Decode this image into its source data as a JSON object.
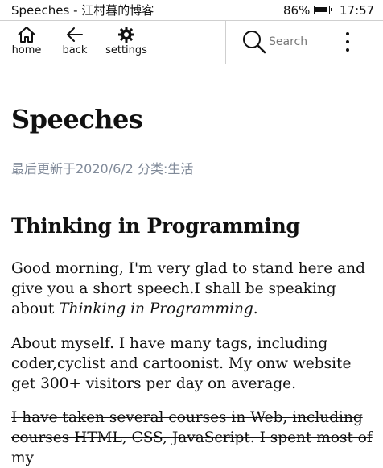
{
  "status_bar": {
    "title": "Speeches - 江村暮的博客",
    "battery": "86%",
    "time": "17:57"
  },
  "toolbar": {
    "home_label": "home",
    "back_label": "back",
    "settings_label": "settings",
    "search_placeholder": "Search",
    "icons": [
      "home-icon",
      "back-arrow-icon",
      "gear-icon",
      "search-icon",
      "more-vertical-icon"
    ]
  },
  "article": {
    "title": "Speeches",
    "meta": "最后更新于2020/6/2 分类:生活",
    "heading": "Thinking in Programming",
    "p1_before": "Good morning, I'm very glad to stand here and give you a short speech.I shall be speaking about ",
    "p1_italic": "Thinking in Programming",
    "p1_after": ".",
    "p2": "About myself. I have many tags, including coder,cyclist and cartoonist. My onw website get 300+ visitors per day on average.",
    "p3": "I have taken several courses in Web, including courses HTML, CSS, JavaScript. I spent most of my"
  }
}
